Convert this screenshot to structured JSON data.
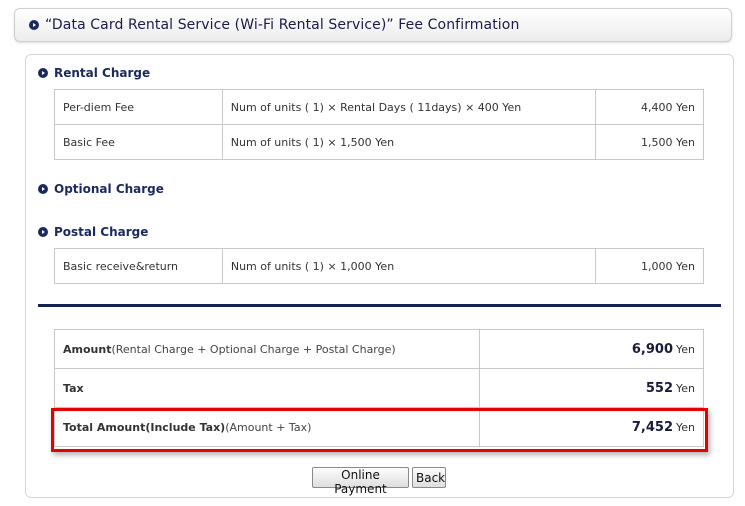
{
  "header": {
    "title": "“Data Card Rental Service (Wi-Fi Rental Service)” Fee Confirmation"
  },
  "sections": {
    "rental": {
      "heading": "Rental Charge",
      "rows": [
        {
          "item": "Per-diem Fee",
          "detail": "Num of units ( 1) × Rental Days ( 11days) × 400 Yen",
          "amount": "4,400 Yen"
        },
        {
          "item": "Basic Fee",
          "detail": "Num of units ( 1) × 1,500 Yen",
          "amount": "1,500 Yen"
        }
      ]
    },
    "optional": {
      "heading": "Optional Charge"
    },
    "postal": {
      "heading": "Postal Charge",
      "rows": [
        {
          "item": "Basic receive&return",
          "detail": "Num of units ( 1) × 1,000 Yen",
          "amount": "1,000 Yen"
        }
      ]
    }
  },
  "summary": {
    "amount": {
      "label": "Amount",
      "note": "(Rental Charge + Optional Charge + Postal Charge)",
      "value": "6,900",
      "unit": "Yen"
    },
    "tax": {
      "label": "Tax",
      "value": "552",
      "unit": "Yen"
    },
    "total": {
      "label": "Total Amount(Include Tax)",
      "note": "(Amount + Tax)",
      "value": "7,452",
      "unit": "Yen"
    }
  },
  "buttons": {
    "online_payment": "Online Payment",
    "back": "Back"
  },
  "colors": {
    "heading_navy": "#1b2a5e",
    "divider": "#16234f",
    "highlight_red": "#e60000"
  }
}
